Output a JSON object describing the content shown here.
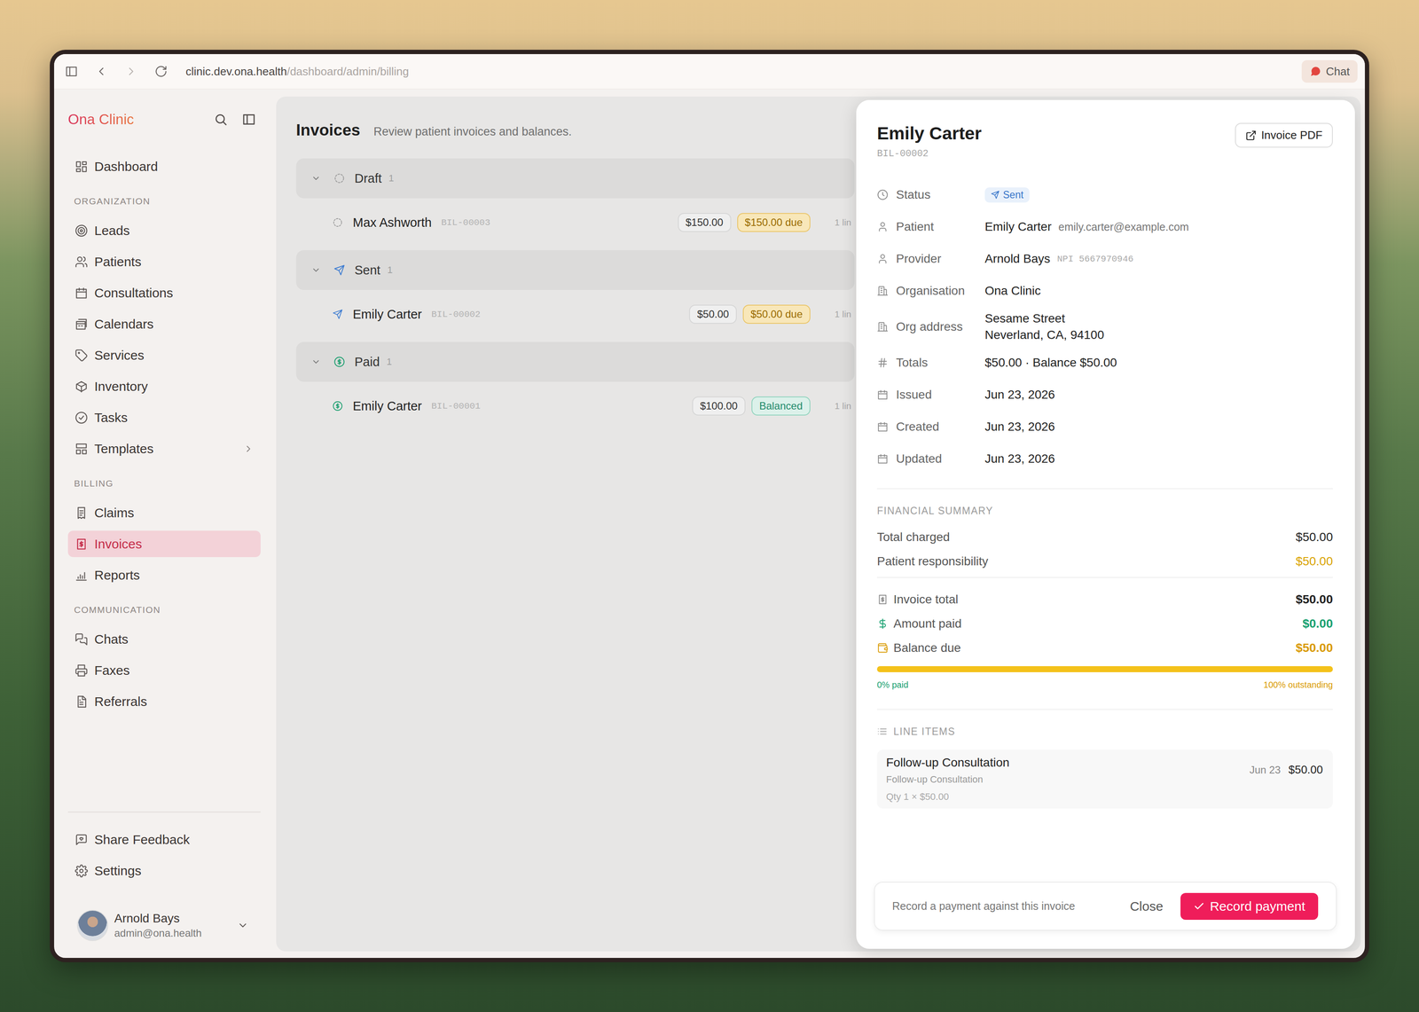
{
  "window": {
    "url_host": "clinic.dev.ona.health",
    "url_path": "/dashboard/admin/billing",
    "chat_button": "Chat"
  },
  "sidebar": {
    "logo": "Ona Clinic",
    "nav": [
      {
        "kind": "item",
        "label": "Dashboard",
        "selected": false,
        "expandable": false
      },
      {
        "kind": "section",
        "label": "ORGANIZATION"
      },
      {
        "kind": "item",
        "label": "Leads",
        "selected": false,
        "expandable": false
      },
      {
        "kind": "item",
        "label": "Patients",
        "selected": false,
        "expandable": false
      },
      {
        "kind": "item",
        "label": "Consultations",
        "selected": false,
        "expandable": false
      },
      {
        "kind": "item",
        "label": "Calendars",
        "selected": false,
        "expandable": false
      },
      {
        "kind": "item",
        "label": "Services",
        "selected": false,
        "expandable": false
      },
      {
        "kind": "item",
        "label": "Inventory",
        "selected": false,
        "expandable": false
      },
      {
        "kind": "item",
        "label": "Tasks",
        "selected": false,
        "expandable": false
      },
      {
        "kind": "item",
        "label": "Templates",
        "selected": false,
        "expandable": true
      },
      {
        "kind": "section",
        "label": "BILLING"
      },
      {
        "kind": "item",
        "label": "Claims",
        "selected": false,
        "expandable": false
      },
      {
        "kind": "item",
        "label": "Invoices",
        "selected": true,
        "expandable": false
      },
      {
        "kind": "item",
        "label": "Reports",
        "selected": false,
        "expandable": false
      },
      {
        "kind": "section",
        "label": "COMMUNICATION"
      },
      {
        "kind": "item",
        "label": "Chats",
        "selected": false,
        "expandable": false
      },
      {
        "kind": "item",
        "label": "Faxes",
        "selected": false,
        "expandable": false
      },
      {
        "kind": "item",
        "label": "Referrals",
        "selected": false,
        "expandable": false
      }
    ],
    "footer": [
      {
        "label": "Share Feedback"
      },
      {
        "label": "Settings"
      }
    ],
    "user": {
      "name": "Arnold Bays",
      "email": "admin@ona.health"
    }
  },
  "main": {
    "title": "Invoices",
    "subtitle": "Review patient invoices and balances.",
    "groups": [
      {
        "kind": "draft",
        "label": "Draft",
        "count": "1",
        "expanded": true,
        "color": "#9a9a9a",
        "rows": [
          {
            "name": "Max Ashworth",
            "id": "BIL-00003",
            "amount": "$150.00",
            "balance": "$150.00 due",
            "balance_state": "due",
            "lines": "1 lin"
          }
        ]
      },
      {
        "kind": "sent",
        "label": "Sent",
        "count": "1",
        "expanded": true,
        "color": "#3b7bd1",
        "rows": [
          {
            "name": "Emily Carter",
            "id": "BIL-00002",
            "amount": "$50.00",
            "balance": "$50.00 due",
            "balance_state": "due",
            "lines": "1 lin"
          }
        ]
      },
      {
        "kind": "paid",
        "label": "Paid",
        "count": "1",
        "expanded": true,
        "color": "#1a9e6e",
        "rows": [
          {
            "name": "Emily Carter",
            "id": "BIL-00001",
            "amount": "$100.00",
            "balance": "Balanced",
            "balance_state": "balanced",
            "lines": "1 lin"
          }
        ]
      }
    ]
  },
  "drawer": {
    "title": "Emily Carter",
    "id": "BIL-00002",
    "pdf_button": "Invoice PDF",
    "details": [
      {
        "label": "Status",
        "kind": "badge",
        "value": "Sent"
      },
      {
        "label": "Patient",
        "kind": "person",
        "value": "Emily Carter",
        "extra": "emily.carter@example.com"
      },
      {
        "label": "Provider",
        "kind": "code",
        "value": "Arnold Bays",
        "extra": "NPI 5667970946"
      },
      {
        "label": "Organisation",
        "kind": "text",
        "value": "Ona Clinic"
      },
      {
        "label": "Org address",
        "kind": "lines",
        "lines": [
          "Sesame Street",
          "Neverland, CA, 94100"
        ]
      },
      {
        "label": "Totals",
        "kind": "text",
        "value": "$50.00 · Balance $50.00"
      },
      {
        "label": "Issued",
        "kind": "text",
        "value": "Jun 23, 2026"
      },
      {
        "label": "Created",
        "kind": "text",
        "value": "Jun 23, 2026"
      },
      {
        "label": "Updated",
        "kind": "text",
        "value": "Jun 23, 2026"
      }
    ],
    "summary": {
      "title": "FINANCIAL SUMMARY",
      "charges": [
        {
          "label": "Total charged",
          "value": "$50.00",
          "color": "#1f1f1f"
        },
        {
          "label": "Patient responsibility",
          "value": "$50.00",
          "color": "#d9a300"
        }
      ],
      "totals": [
        {
          "label": "Invoice total",
          "value": "$50.00",
          "color": "#1f1f1f"
        },
        {
          "label": "Amount paid",
          "value": "$0.00",
          "color": "#16a06f"
        },
        {
          "label": "Balance due",
          "value": "$50.00",
          "color": "#d99a00"
        }
      ],
      "progress": {
        "level": 0,
        "paid_label": "0% paid",
        "outstanding_label": "100% outstanding"
      }
    },
    "line_items": {
      "title": "LINE ITEMS",
      "items": [
        {
          "name": "Follow-up Consultation",
          "description": "Follow-up Consultation",
          "qty": "Qty 1 × $50.00",
          "date": "Jun 23",
          "amount": "$50.00"
        }
      ]
    },
    "footer": {
      "hint": "Record a payment against this invoice",
      "close": "Close",
      "primary": "Record payment"
    }
  }
}
